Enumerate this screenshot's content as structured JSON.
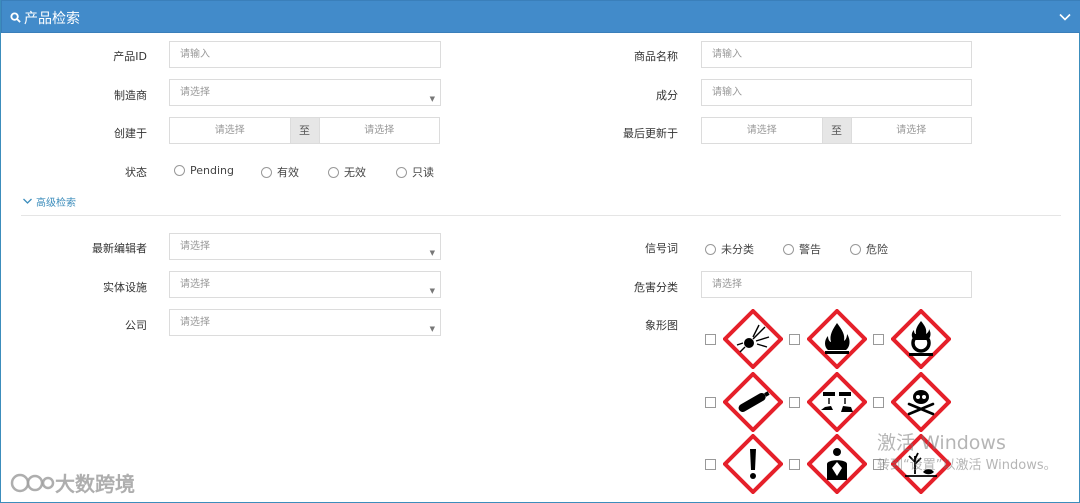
{
  "header": {
    "title": "产品检索"
  },
  "fields": {
    "product_id": {
      "label": "产品ID",
      "placeholder": "请输入"
    },
    "product_name": {
      "label": "商品名称",
      "placeholder": "请输入"
    },
    "manufacturer": {
      "label": "制造商",
      "placeholder": "请选择"
    },
    "ingredient": {
      "label": "成分",
      "placeholder": "请输入"
    },
    "created": {
      "label": "创建于",
      "from": "请选择",
      "sep": "至",
      "to": "请选择"
    },
    "updated": {
      "label": "最后更新于",
      "from": "请选择",
      "sep": "至",
      "to": "请选择"
    },
    "status": {
      "label": "状态",
      "options": [
        "Pending",
        "有效",
        "无效",
        "只读"
      ]
    }
  },
  "advanced": {
    "toggle_label": "高级检索",
    "latest_editor": {
      "label": "最新编辑者",
      "placeholder": "请选择"
    },
    "signal_word": {
      "label": "信号词",
      "options": [
        "未分类",
        "警告",
        "危险"
      ]
    },
    "entity_facility": {
      "label": "实体设施",
      "placeholder": "请选择"
    },
    "hazard_class": {
      "label": "危害分类",
      "placeholder": "请选择"
    },
    "company": {
      "label": "公司",
      "placeholder": "请选择"
    },
    "pictogram": {
      "label": "象形图",
      "items": [
        "exploding-bomb-icon",
        "flame-icon",
        "flame-over-circle-icon",
        "gas-cylinder-icon",
        "corrosion-icon",
        "skull-crossbones-icon",
        "exclamation-mark-icon",
        "health-hazard-icon",
        "environment-icon"
      ]
    }
  },
  "watermark": {
    "activate_title": "激活 Windows",
    "activate_sub": "转到“设置”以激活 Windows。",
    "logo_text": "大数跨境"
  },
  "colors": {
    "header_bg": "#428bca",
    "ghs_red": "#e5202a",
    "link": "#3c8dbc"
  }
}
